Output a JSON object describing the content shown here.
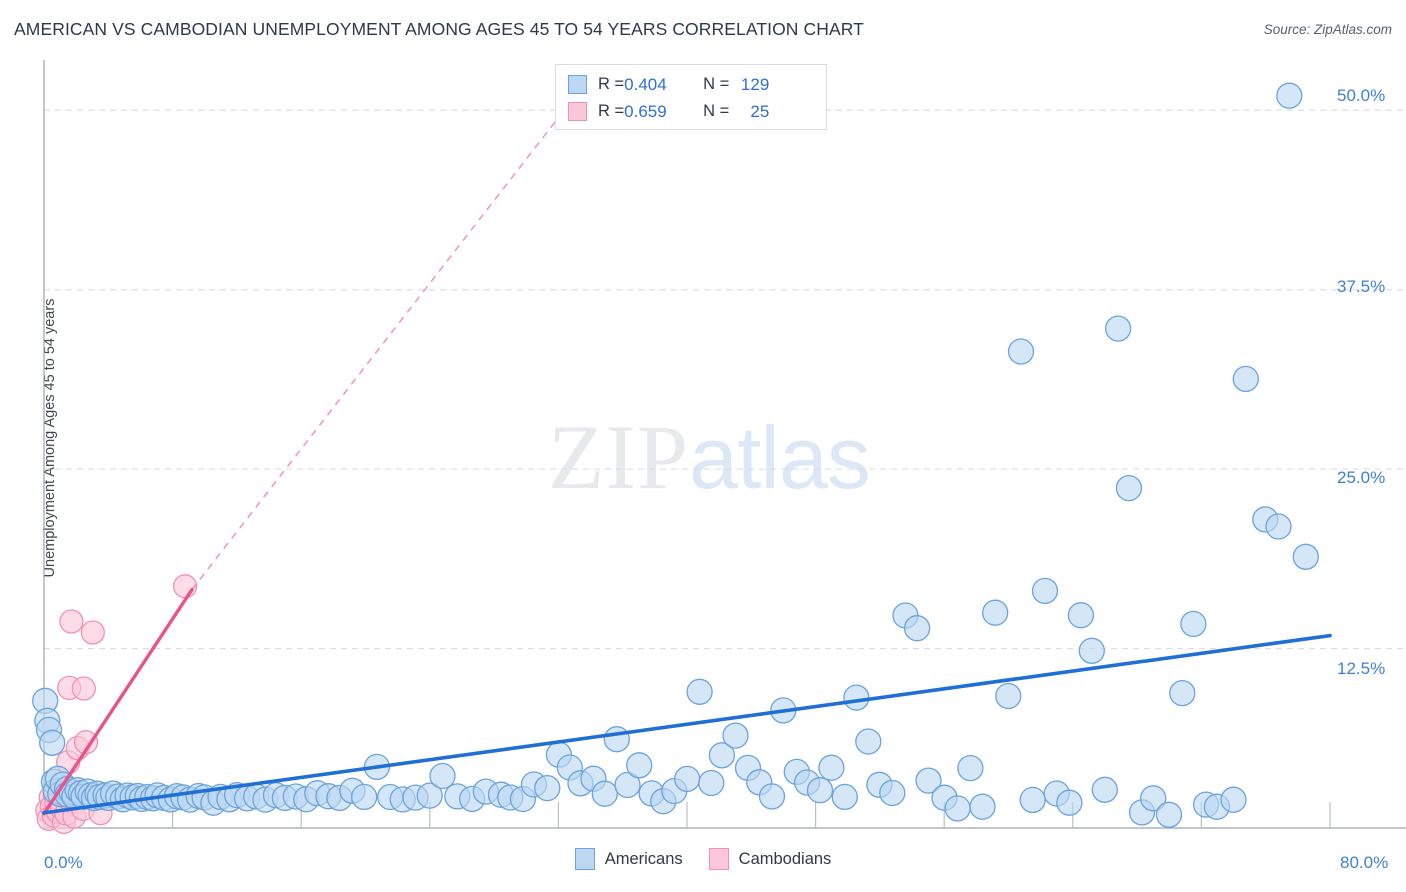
{
  "header": {
    "title": "AMERICAN VS CAMBODIAN UNEMPLOYMENT AMONG AGES 45 TO 54 YEARS CORRELATION CHART",
    "source": "Source: ZipAtlas.com"
  },
  "watermark": {
    "part1": "ZIP",
    "part2": "atlas"
  },
  "stats_legend": {
    "rows": [
      {
        "series": "Americans",
        "r_label": "R = ",
        "r_value": "0.404",
        "n_label": "N = ",
        "n_value": "129",
        "color": "#bcd7f2",
        "border": "#6aa3dd"
      },
      {
        "series": "Cambodians",
        "r_label": "R = ",
        "r_value": "0.659",
        "n_label": "N = ",
        "n_value": "25",
        "color": "#fbc7d9",
        "border": "#f091b3"
      }
    ]
  },
  "series_legend": [
    {
      "label": "Americans",
      "color": "#bcd7f2",
      "border": "#6aa3dd"
    },
    {
      "label": "Cambodians",
      "color": "#fbc7d9",
      "border": "#f091b3"
    }
  ],
  "chart_data": {
    "type": "scatter",
    "title": "AMERICAN VS CAMBODIAN UNEMPLOYMENT AMONG AGES 45 TO 54 YEARS CORRELATION CHART",
    "xlabel": "",
    "ylabel": "Unemployment Among Ages 45 to 54 years",
    "xlim": [
      0,
      80
    ],
    "ylim": [
      0,
      53.5
    ],
    "x_tick_labels": [
      "0.0%",
      "80.0%"
    ],
    "y_tick_labels": [
      "12.5%",
      "25.0%",
      "37.5%",
      "50.0%"
    ],
    "y_ticks": [
      12.5,
      25.0,
      37.5,
      50.0
    ],
    "x_ticks": [
      0,
      8,
      16,
      24,
      32,
      40,
      48,
      56,
      64,
      72,
      80
    ],
    "grid": true,
    "legend_position": "bottom-center",
    "accent_color": "#2f6fd0",
    "series": [
      {
        "name": "Americans",
        "r": 0.404,
        "n": 129,
        "marker_fill": "#bcd7f2",
        "marker_stroke": "#6aa3dd",
        "trend_color": "#1f6fd4",
        "trend": {
          "x0": 0,
          "y0": 1.05,
          "x1": 80,
          "y1": 13.4
        },
        "points": [
          [
            0.1,
            8.9
          ],
          [
            0.2,
            7.5
          ],
          [
            0.3,
            6.8
          ],
          [
            0.5,
            5.9
          ],
          [
            0.6,
            3.2
          ],
          [
            0.7,
            2.6
          ],
          [
            0.9,
            3.4
          ],
          [
            1.0,
            2.4
          ],
          [
            1.2,
            3.0
          ],
          [
            1.4,
            2.7
          ],
          [
            1.5,
            2.3
          ],
          [
            1.7,
            2.5
          ],
          [
            1.9,
            2.2
          ],
          [
            2.1,
            2.6
          ],
          [
            2.3,
            2.4
          ],
          [
            2.5,
            2.2
          ],
          [
            2.7,
            2.5
          ],
          [
            2.9,
            2.3
          ],
          [
            3.1,
            2.1
          ],
          [
            3.3,
            2.4
          ],
          [
            3.5,
            2.2
          ],
          [
            3.8,
            2.3
          ],
          [
            4.0,
            2.1
          ],
          [
            4.3,
            2.4
          ],
          [
            4.6,
            2.2
          ],
          [
            4.9,
            2.0
          ],
          [
            5.2,
            2.3
          ],
          [
            5.5,
            2.1
          ],
          [
            5.8,
            2.2
          ],
          [
            6.1,
            2.0
          ],
          [
            6.4,
            2.2
          ],
          [
            6.8,
            2.1
          ],
          [
            7.1,
            2.3
          ],
          [
            7.5,
            2.1
          ],
          [
            7.9,
            2.0
          ],
          [
            8.3,
            2.2
          ],
          [
            8.7,
            2.1
          ],
          [
            9.1,
            2.0
          ],
          [
            9.6,
            2.2
          ],
          [
            10.0,
            2.1
          ],
          [
            10.5,
            1.8
          ],
          [
            11.0,
            2.2
          ],
          [
            11.5,
            2.0
          ],
          [
            12.0,
            2.3
          ],
          [
            12.6,
            2.1
          ],
          [
            13.2,
            2.2
          ],
          [
            13.8,
            2.0
          ],
          [
            14.4,
            2.3
          ],
          [
            15.0,
            2.1
          ],
          [
            15.7,
            2.2
          ],
          [
            16.3,
            2.0
          ],
          [
            17.0,
            2.4
          ],
          [
            17.7,
            2.2
          ],
          [
            18.4,
            2.1
          ],
          [
            19.2,
            2.6
          ],
          [
            19.9,
            2.2
          ],
          [
            20.7,
            4.3
          ],
          [
            21.5,
            2.2
          ],
          [
            22.3,
            2.0
          ],
          [
            23.1,
            2.1
          ],
          [
            24.0,
            2.3
          ],
          [
            24.8,
            3.6
          ],
          [
            25.7,
            2.2
          ],
          [
            26.6,
            2.0
          ],
          [
            27.5,
            2.5
          ],
          [
            28.4,
            2.3
          ],
          [
            29.0,
            2.1
          ],
          [
            29.8,
            2.0
          ],
          [
            30.5,
            3.0
          ],
          [
            31.3,
            2.8
          ],
          [
            32.0,
            5.1
          ],
          [
            32.7,
            4.2
          ],
          [
            33.4,
            3.1
          ],
          [
            34.2,
            3.4
          ],
          [
            34.9,
            2.4
          ],
          [
            35.6,
            6.2
          ],
          [
            36.3,
            3.0
          ],
          [
            37.0,
            4.4
          ],
          [
            37.8,
            2.4
          ],
          [
            38.5,
            1.9
          ],
          [
            39.2,
            2.6
          ],
          [
            40.0,
            3.4
          ],
          [
            40.8,
            9.5
          ],
          [
            41.5,
            3.1
          ],
          [
            42.2,
            5.1
          ],
          [
            43.0,
            6.4
          ],
          [
            43.8,
            4.2
          ],
          [
            44.5,
            3.2
          ],
          [
            45.3,
            2.2
          ],
          [
            46.0,
            8.2
          ],
          [
            46.8,
            3.9
          ],
          [
            47.5,
            3.2
          ],
          [
            48.3,
            2.6
          ],
          [
            49.0,
            4.2
          ],
          [
            49.8,
            2.2
          ],
          [
            50.5,
            9.1
          ],
          [
            51.3,
            6.0
          ],
          [
            52.0,
            3.0
          ],
          [
            52.8,
            2.4
          ],
          [
            53.6,
            14.8
          ],
          [
            54.3,
            13.9
          ],
          [
            55.0,
            3.3
          ],
          [
            56.0,
            2.1
          ],
          [
            56.8,
            1.4
          ],
          [
            57.6,
            4.2
          ],
          [
            58.4,
            1.5
          ],
          [
            59.2,
            15.0
          ],
          [
            60.0,
            9.2
          ],
          [
            60.8,
            33.2
          ],
          [
            61.5,
            2.0
          ],
          [
            62.3,
            16.5
          ],
          [
            63.0,
            2.4
          ],
          [
            63.8,
            1.8
          ],
          [
            64.5,
            14.8
          ],
          [
            65.2,
            12.3
          ],
          [
            66.0,
            2.7
          ],
          [
            66.8,
            34.8
          ],
          [
            67.5,
            23.7
          ],
          [
            68.3,
            1.1
          ],
          [
            69.0,
            2.1
          ],
          [
            70.0,
            0.9
          ],
          [
            70.8,
            9.4
          ],
          [
            71.5,
            14.2
          ],
          [
            72.3,
            1.6
          ],
          [
            73.0,
            1.5
          ],
          [
            74.0,
            2.0
          ],
          [
            74.8,
            31.3
          ],
          [
            76.0,
            21.5
          ],
          [
            76.8,
            21.0
          ],
          [
            77.5,
            51.0
          ],
          [
            78.5,
            18.9
          ]
        ]
      },
      {
        "name": "Cambodians",
        "r": 0.659,
        "n": 25,
        "marker_fill": "#fbc7d9",
        "marker_stroke": "#f091b3",
        "trend_color": "#e8538a",
        "trend_solid": {
          "x0": 0.0,
          "y0": 1.0,
          "x1": 9.2,
          "y1": 16.6
        },
        "trend_dashed": {
          "x0": 9.2,
          "y0": 16.6,
          "x1": 32.5,
          "y1": 50.2
        },
        "points": [
          [
            0.2,
            1.2
          ],
          [
            0.3,
            0.6
          ],
          [
            0.4,
            2.1
          ],
          [
            0.5,
            1.5
          ],
          [
            0.6,
            0.9
          ],
          [
            0.7,
            2.4
          ],
          [
            0.8,
            1.8
          ],
          [
            0.9,
            1.1
          ],
          [
            1.0,
            3.0
          ],
          [
            1.1,
            1.4
          ],
          [
            1.2,
            0.4
          ],
          [
            1.3,
            2.2
          ],
          [
            1.4,
            1.0
          ],
          [
            1.5,
            4.6
          ],
          [
            1.7,
            1.9
          ],
          [
            1.9,
            0.8
          ],
          [
            2.1,
            5.6
          ],
          [
            2.4,
            1.3
          ],
          [
            2.6,
            6.0
          ],
          [
            1.6,
            9.8
          ],
          [
            2.5,
            9.7
          ],
          [
            1.7,
            14.4
          ],
          [
            3.0,
            13.6
          ],
          [
            3.5,
            1.0
          ],
          [
            8.8,
            16.8
          ]
        ]
      }
    ]
  }
}
